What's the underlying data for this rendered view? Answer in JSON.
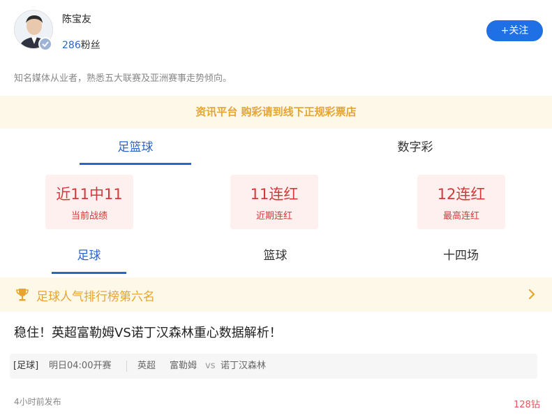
{
  "profile": {
    "name": "陈宝友",
    "fans_count": "286",
    "fans_label": "粉丝",
    "follow_button": "+关注",
    "bio": "知名媒体从业者，熟悉五大联赛及亚洲赛事走势倾向。"
  },
  "notice": "资讯平台 购彩请到线下正规彩票店",
  "category_tabs": [
    {
      "label": "足篮球",
      "active": true
    },
    {
      "label": "数字彩",
      "active": false
    }
  ],
  "stats": [
    {
      "value": "近11中11",
      "label": "当前战绩"
    },
    {
      "value": "11连红",
      "label": "近期连红"
    },
    {
      "value": "12连红",
      "label": "最高连红"
    }
  ],
  "sport_tabs": [
    {
      "label": "足球",
      "active": true
    },
    {
      "label": "篮球",
      "active": false
    },
    {
      "label": "十四场",
      "active": false
    }
  ],
  "ranking": {
    "icon": "trophy-icon",
    "label": "足球人气排行榜第六名"
  },
  "article": {
    "title": "稳住！英超富勒姆VS诺丁汉森林重心数据解析！",
    "tag": "[足球]",
    "kickoff": "明日04:00开赛",
    "league": "英超",
    "home": "富勒姆",
    "vs": "vs",
    "away": "诺丁汉森林",
    "posted": "4小时前发布",
    "price": "128钻"
  },
  "colors": {
    "accent_blue": "#2a66c9",
    "button_blue": "#1f6fe5",
    "gold": "#e6a531",
    "red": "#d23a3a",
    "notice_bg": "#fdf8e7"
  }
}
